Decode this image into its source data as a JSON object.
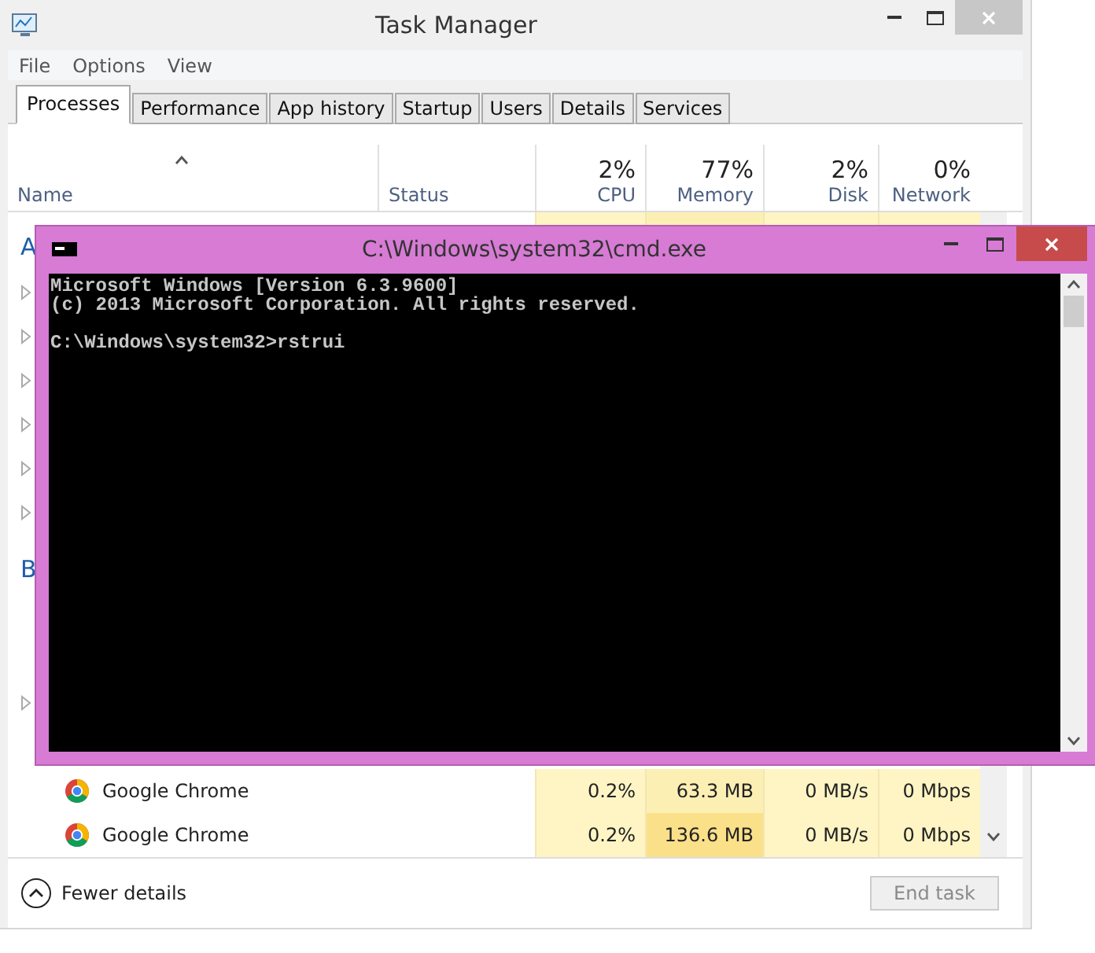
{
  "task_manager": {
    "title": "Task Manager",
    "menu": [
      "File",
      "Options",
      "View"
    ],
    "tabs": [
      {
        "label": "Processes",
        "selected": true
      },
      {
        "label": "Performance",
        "selected": false
      },
      {
        "label": "App history",
        "selected": false
      },
      {
        "label": "Startup",
        "selected": false
      },
      {
        "label": "Users",
        "selected": false
      },
      {
        "label": "Details",
        "selected": false
      },
      {
        "label": "Services",
        "selected": false
      }
    ],
    "columns": [
      {
        "label": "Name"
      },
      {
        "label": "Status"
      },
      {
        "percent": "2%",
        "label": "CPU"
      },
      {
        "percent": "77%",
        "label": "Memory"
      },
      {
        "percent": "2%",
        "label": "Disk"
      },
      {
        "percent": "0%",
        "label": "Network"
      }
    ],
    "rows": [
      {
        "kind": "group",
        "label": "A"
      },
      {
        "kind": "collapsed"
      },
      {
        "kind": "collapsed"
      },
      {
        "kind": "collapsed"
      },
      {
        "kind": "collapsed"
      },
      {
        "kind": "collapsed"
      },
      {
        "kind": "collapsed"
      },
      {
        "kind": "group",
        "label": "B"
      },
      {
        "kind": "blank"
      },
      {
        "kind": "blank"
      },
      {
        "kind": "collapsed"
      },
      {
        "kind": "blank"
      },
      {
        "kind": "process",
        "name": "Google Chrome",
        "cells": [
          "0.2%",
          "63.3 MB",
          "0 MB/s",
          "0 Mbps"
        ]
      },
      {
        "kind": "process",
        "name": "Google Chrome",
        "cells": [
          "0.2%",
          "136.6 MB",
          "0 MB/s",
          "0 Mbps"
        ]
      }
    ],
    "fewer_details": "Fewer details",
    "end_task": {
      "label": "End task",
      "disabled": true
    }
  },
  "cmd": {
    "title": "C:\\Windows\\system32\\cmd.exe",
    "blocks": [
      [
        "Microsoft Windows [Version 6.3.9600]",
        "(c) 2013 Microsoft Corporation. All rights reserved."
      ],
      [
        "C:\\Windows\\system32>rstrui"
      ]
    ]
  }
}
